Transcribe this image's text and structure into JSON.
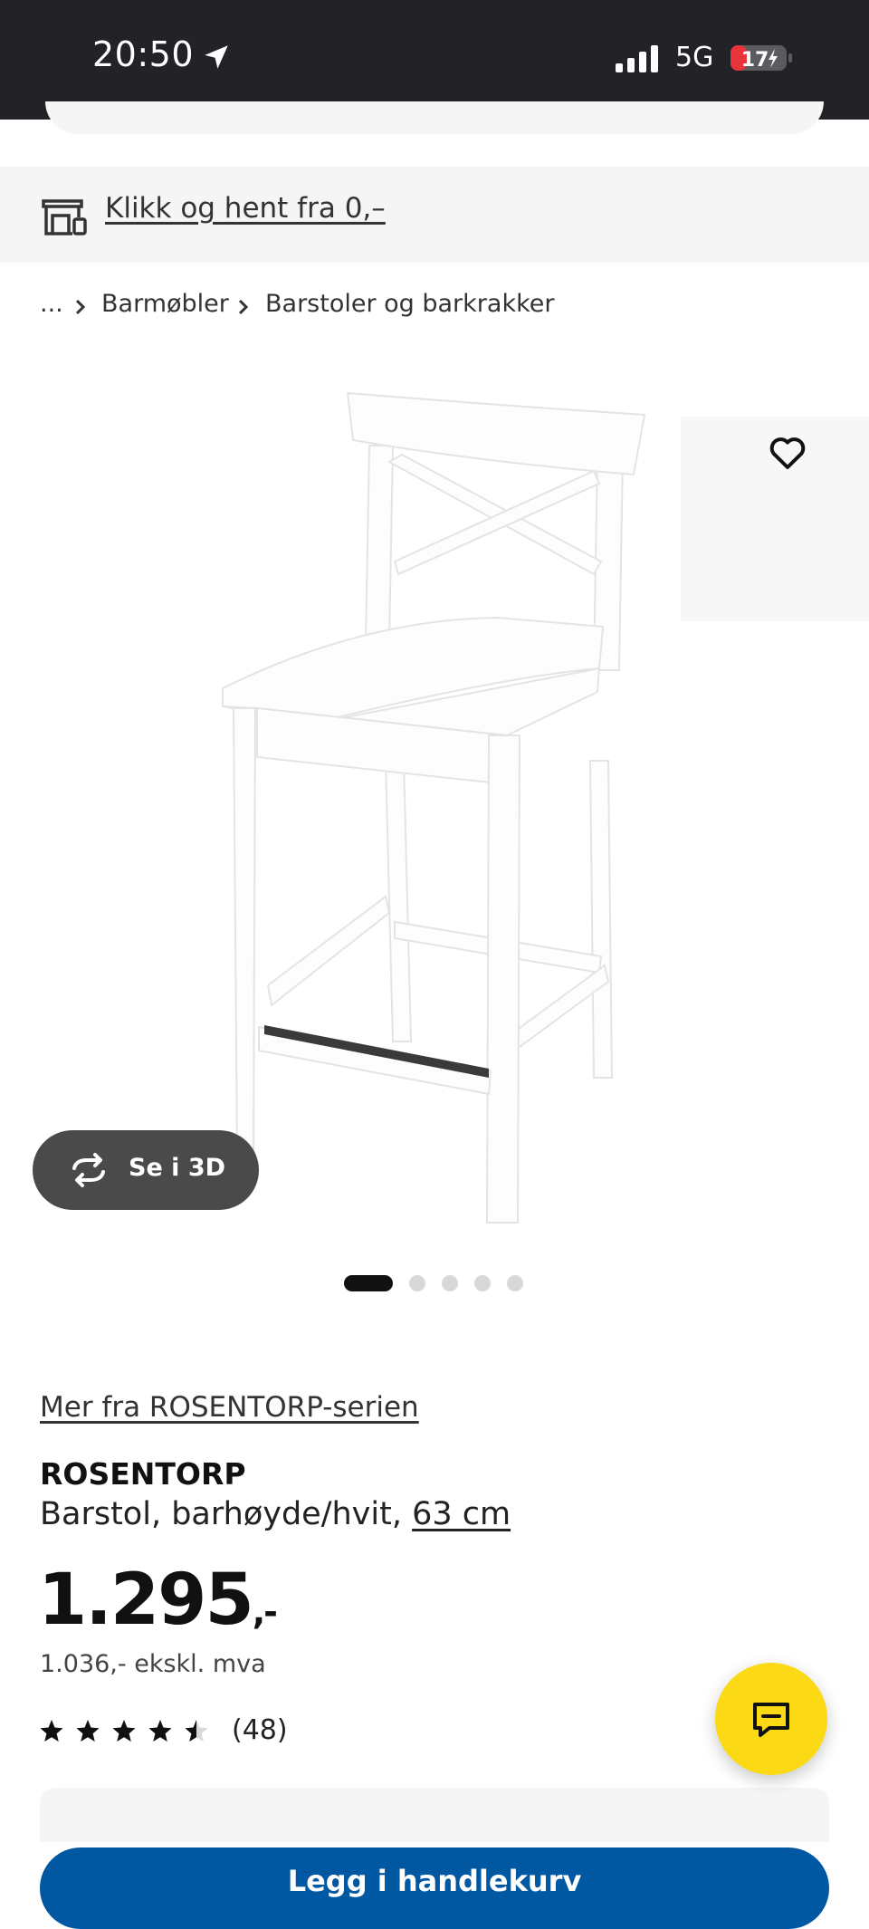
{
  "status_bar": {
    "time": "20:50",
    "network": "5G",
    "battery": "17"
  },
  "banner": {
    "text": "Klikk og hent fra 0,–"
  },
  "breadcrumb": {
    "ellipsis": "...",
    "items": [
      "Barmøbler",
      "Barstoler og barkrakker"
    ]
  },
  "gallery": {
    "view_3d_label": "Se i 3D",
    "image_count": 5,
    "active_index": 0
  },
  "product": {
    "series_link": "Mer fra ROSENTORP-serien",
    "name": "ROSENTORP",
    "description": "Barstol, barhøyde/hvit,",
    "size_link": "63 cm",
    "price_main": "1.295",
    "price_suffix": ",-",
    "price_ex_vat": "1.036,- ekskl. mva",
    "rating": 4.5,
    "review_count": "(48)"
  },
  "cart_button": {
    "label": "Legg i handlekurv"
  },
  "colors": {
    "status_bar": "#222227",
    "accent_blue": "#0058a3",
    "chat_yellow": "#fbd914"
  },
  "icons": [
    "location-arrow-icon",
    "signal-icon",
    "battery-icon",
    "store-icon",
    "chevron-right-icon",
    "heart-icon",
    "rotate-3d-icon",
    "star-icon",
    "chat-icon"
  ]
}
